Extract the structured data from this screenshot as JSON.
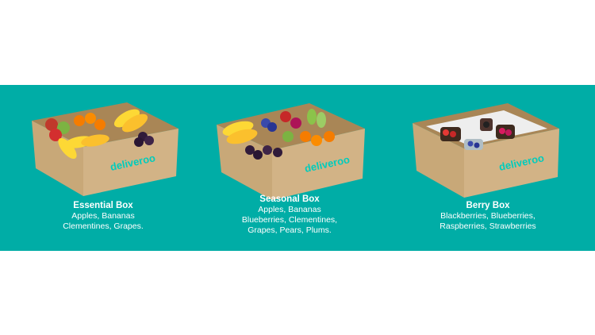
{
  "brand": {
    "name": "deliveroo",
    "color": "#00ccbc"
  },
  "colors": {
    "band": "#00ada6",
    "box": "#c8a878",
    "box_dark": "#a98656",
    "text": "#ffffff"
  },
  "products": [
    {
      "title": "Essential Box",
      "lines": [
        "Apples, Bananas",
        "Clementines, Grapes."
      ]
    },
    {
      "title": "Seasonal Box",
      "lines": [
        "Apples, Bananas",
        "Blueberries, Clementines,",
        "Grapes, Pears, Plums."
      ]
    },
    {
      "title": "Berry Box",
      "lines": [
        "Blackberries, Blueberries,",
        "Raspberries, Strawberries"
      ]
    }
  ]
}
